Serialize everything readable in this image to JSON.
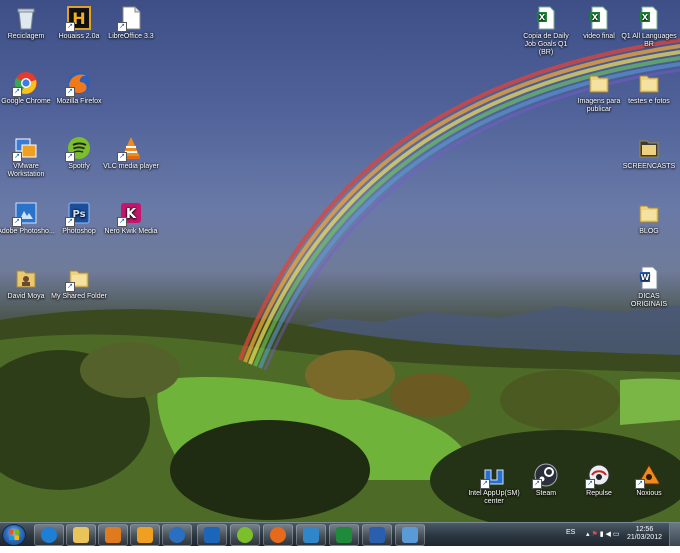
{
  "desktop": {
    "icons_left": [
      {
        "label": "Reciclagem",
        "icon": "recycle-bin-icon"
      },
      {
        "label": "Houaiss 2.0a",
        "icon": "houaiss-icon"
      },
      {
        "label": "LibreOffice 3.3",
        "icon": "libreoffice-icon"
      },
      {
        "label": "Google Chrome",
        "icon": "chrome-icon"
      },
      {
        "label": "Mozilla Firefox",
        "icon": "firefox-icon"
      },
      {
        "label": "VMware Workstation",
        "icon": "vmware-icon"
      },
      {
        "label": "Spotify",
        "icon": "spotify-icon"
      },
      {
        "label": "VLC media player",
        "icon": "vlc-icon"
      },
      {
        "label": "Adobe Photosho...",
        "icon": "adobe-photoshop-icon"
      },
      {
        "label": "Photoshop",
        "icon": "photoshop-icon"
      },
      {
        "label": "Nero Kwik Media",
        "icon": "nero-icon"
      },
      {
        "label": "David Moya",
        "icon": "user-folder-icon"
      },
      {
        "label": "My Shared Folder",
        "icon": "folder-icon"
      }
    ],
    "icons_right": [
      {
        "label": "Copia de Daily Job Goals Q1 (BR)",
        "icon": "excel-file-icon"
      },
      {
        "label": "video final",
        "icon": "excel-file-icon"
      },
      {
        "label": "Q1 All Languages BR",
        "icon": "excel-file-icon"
      },
      {
        "label": "Imagens para publicar",
        "icon": "folder-icon"
      },
      {
        "label": "testes e fotos",
        "icon": "folder-icon"
      },
      {
        "label": "SCREENCASTS",
        "icon": "folder-icon"
      },
      {
        "label": "BLOG",
        "icon": "folder-icon"
      },
      {
        "label": "DICAS ORIGINAIS",
        "icon": "word-file-icon"
      }
    ],
    "icons_bottom": [
      {
        "label": "Intel AppUp(SM) center",
        "icon": "intel-appup-icon"
      },
      {
        "label": "Steam",
        "icon": "steam-icon"
      },
      {
        "label": "Repulse",
        "icon": "repulse-icon"
      },
      {
        "label": "Noxious",
        "icon": "noxious-icon"
      }
    ]
  },
  "taskbar": {
    "pinned": [
      {
        "name": "internet-explorer",
        "color": "#1f7ed6"
      },
      {
        "name": "windows-explorer",
        "color": "#e8c45a"
      },
      {
        "name": "media-player",
        "color": "#e07a1e"
      },
      {
        "name": "outlook",
        "color": "#f0a020"
      },
      {
        "name": "arrow-app",
        "color": "#2b6fc2"
      },
      {
        "name": "photoshop",
        "color": "#1b66b8"
      },
      {
        "name": "spotify",
        "color": "#7bbf2a"
      },
      {
        "name": "firefox",
        "color": "#e66a1c"
      },
      {
        "name": "lync",
        "color": "#2f86c9"
      },
      {
        "name": "excel",
        "color": "#1f8a3a"
      },
      {
        "name": "word",
        "color": "#2a5fb0"
      },
      {
        "name": "remote-desktop",
        "color": "#5a9ad6"
      }
    ],
    "language": "ES",
    "clock_time": "12:56",
    "clock_date": "21/03/2012"
  }
}
